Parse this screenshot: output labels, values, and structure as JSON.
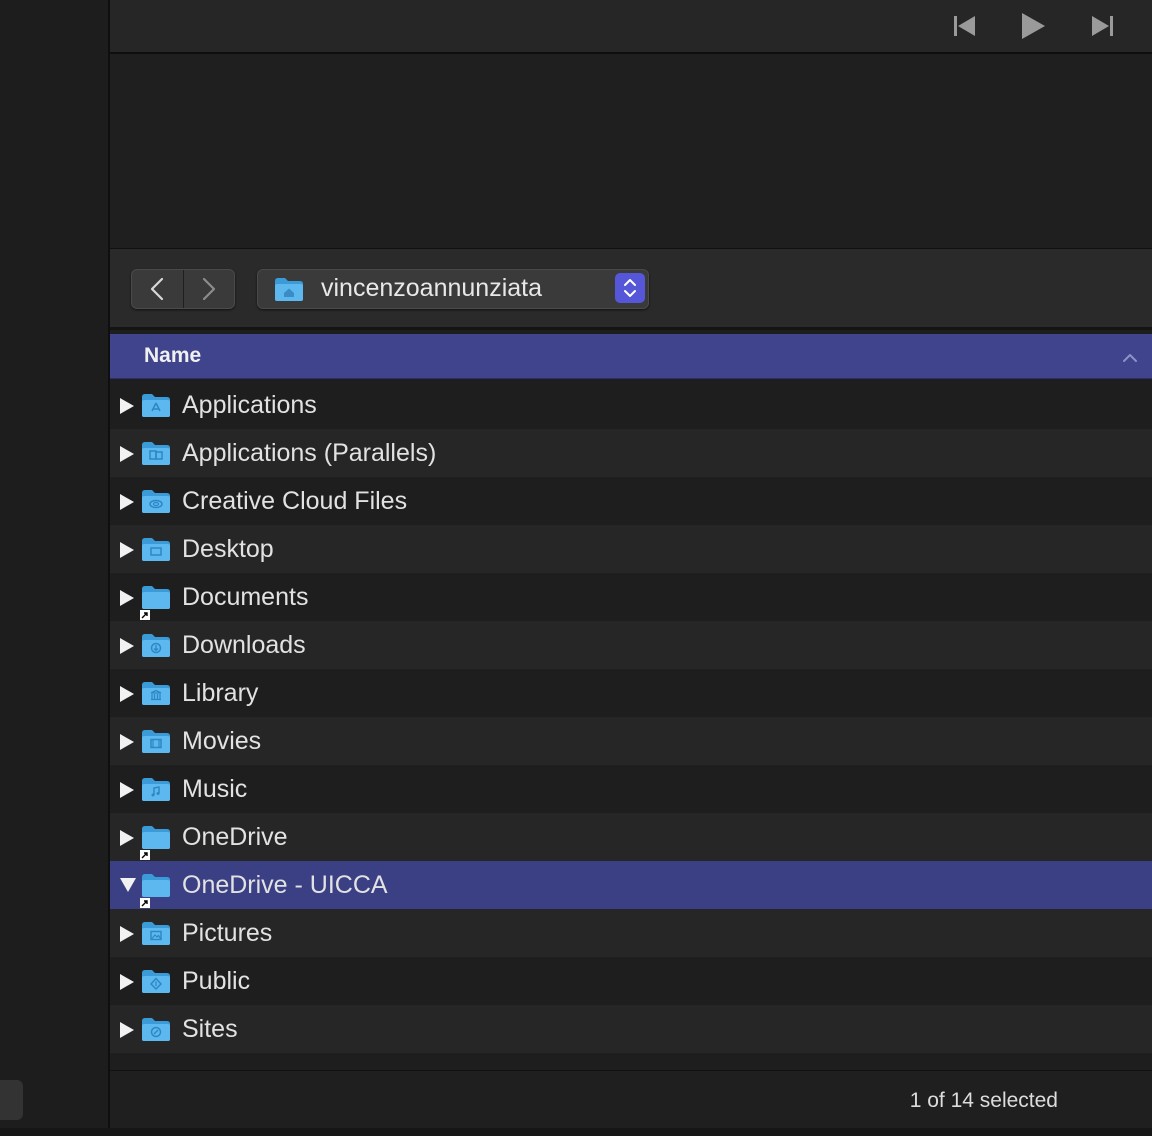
{
  "colors": {
    "accent": "#3f448c",
    "selection": "#3b3f83",
    "folder_blue": "#4fb3ec",
    "stepper": "#5556d8"
  },
  "transport": {
    "previous_icon": "skip-back-icon",
    "play_icon": "play-icon",
    "next_icon": "skip-forward-icon"
  },
  "navigation": {
    "back_icon": "chevron-left-icon",
    "forward_icon": "chevron-right-icon",
    "path": {
      "icon": "home-folder-icon",
      "label": "vincenzoannunziata",
      "stepper_icon": "up-down-chevron-icon"
    }
  },
  "list": {
    "column_name": "Name",
    "sort_icon": "chevron-up-icon",
    "rows": [
      {
        "name": "Applications",
        "icon": "applications-folder-icon",
        "expanded": false,
        "selected": false,
        "alias": false
      },
      {
        "name": "Applications (Parallels)",
        "icon": "parallels-folder-icon",
        "expanded": false,
        "selected": false,
        "alias": false
      },
      {
        "name": "Creative Cloud Files",
        "icon": "creative-cloud-folder-icon",
        "expanded": false,
        "selected": false,
        "alias": false
      },
      {
        "name": "Desktop",
        "icon": "desktop-folder-icon",
        "expanded": false,
        "selected": false,
        "alias": false
      },
      {
        "name": "Documents",
        "icon": "documents-folder-icon",
        "expanded": false,
        "selected": false,
        "alias": true
      },
      {
        "name": "Downloads",
        "icon": "downloads-folder-icon",
        "expanded": false,
        "selected": false,
        "alias": false
      },
      {
        "name": "Library",
        "icon": "library-folder-icon",
        "expanded": false,
        "selected": false,
        "alias": false
      },
      {
        "name": "Movies",
        "icon": "movies-folder-icon",
        "expanded": false,
        "selected": false,
        "alias": false
      },
      {
        "name": "Music",
        "icon": "music-folder-icon",
        "expanded": false,
        "selected": false,
        "alias": false
      },
      {
        "name": "OneDrive",
        "icon": "onedrive-folder-icon",
        "expanded": false,
        "selected": false,
        "alias": true
      },
      {
        "name": "OneDrive - UICCA",
        "icon": "onedrive-uicca-folder-icon",
        "expanded": true,
        "selected": true,
        "alias": true
      },
      {
        "name": "Pictures",
        "icon": "pictures-folder-icon",
        "expanded": false,
        "selected": false,
        "alias": false
      },
      {
        "name": "Public",
        "icon": "public-folder-icon",
        "expanded": false,
        "selected": false,
        "alias": false
      },
      {
        "name": "Sites",
        "icon": "sites-folder-icon",
        "expanded": false,
        "selected": false,
        "alias": false
      }
    ]
  },
  "status": {
    "text": "1 of 14 selected"
  }
}
